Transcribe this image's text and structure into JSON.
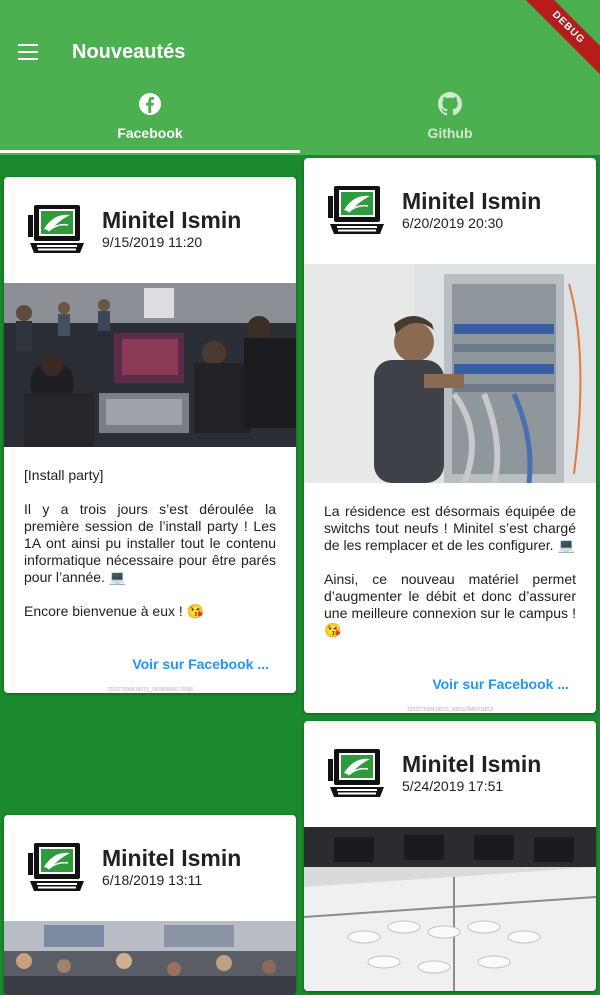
{
  "appbar": {
    "title": "Nouveautés",
    "debug_label": "DEBUG",
    "menu_icon": "hamburger-menu-icon"
  },
  "tabs": [
    {
      "label": "Facebook",
      "icon": "facebook-icon",
      "selected": true
    },
    {
      "label": "Github",
      "icon": "github-icon",
      "selected": false
    }
  ],
  "posts": [
    {
      "author": "Minitel Ismin",
      "date": "9/15/2019 11:20",
      "paragraphs": [
        "[Install party]",
        "Il y a trois jours s’est déroulée la première session de l’install party ! Les 1A ont ainsi pu installer tout le contenu informatique nécessaire pour être parés pour l’année. 💻",
        "Encore bienvenue à eux ! 😘"
      ],
      "link": "Voir sur Facebook ...",
      "post_id": "720227598418573_740969846174586"
    },
    {
      "author": "Minitel Ismin",
      "date": "6/20/2019 20:30",
      "paragraphs": [
        "La résidence est désormais équipée de switchs tout neufs ! Minitel s’est chargé de les remplacer et de les configurer. 💻",
        "Ainsi, ce nouveau matériel permet d’augmenter le débit et donc d’assurer une meilleure connexion sur le campus ! 😘"
      ],
      "link": "Voir sur Facebook ...",
      "post_id": "720227598418573_688157846201819"
    },
    {
      "author": "Minitel Ismin",
      "date": "5/24/2019 17:51"
    },
    {
      "author": "Minitel Ismin",
      "date": "6/18/2019 13:11"
    }
  ],
  "colors": {
    "primary": "#4caf50",
    "background": "#1b8a2e",
    "link": "#2196f3",
    "debug_ribbon": "#b71c1c"
  }
}
